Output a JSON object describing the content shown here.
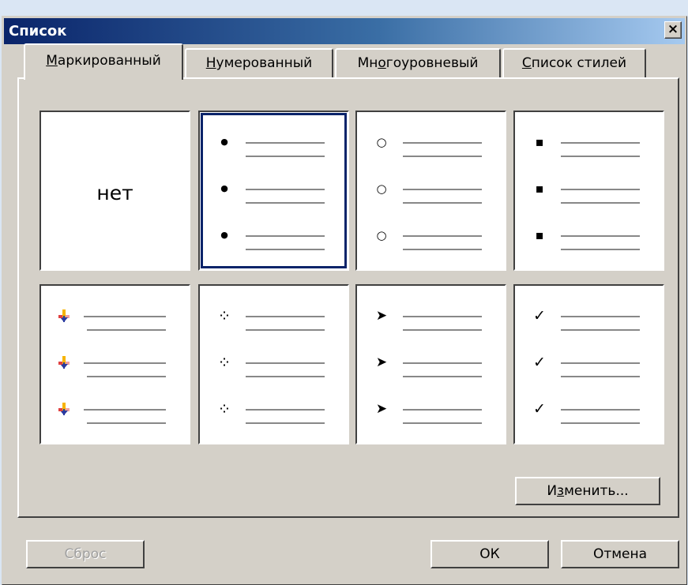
{
  "dialog": {
    "title": "Список"
  },
  "tabs": [
    {
      "pre": "",
      "u": "М",
      "post": "аркированный"
    },
    {
      "pre": "",
      "u": "Н",
      "post": "умерованный"
    },
    {
      "pre": "Мн",
      "u": "о",
      "post": "гоуровневый"
    },
    {
      "pre": "",
      "u": "С",
      "post": "писок стилей"
    }
  ],
  "grid": {
    "none_label": "нет",
    "selected_index": 1,
    "cells": [
      "none",
      "filled-circle",
      "hollow-circle",
      "square",
      "picture-marker",
      "diamond-dots",
      "arrowhead",
      "checkmark"
    ]
  },
  "buttons": {
    "modify": {
      "pre": "И",
      "u": "з",
      "post": "менить..."
    },
    "reset": "Сброс",
    "ok": "ОК",
    "cancel": "Отмена"
  }
}
